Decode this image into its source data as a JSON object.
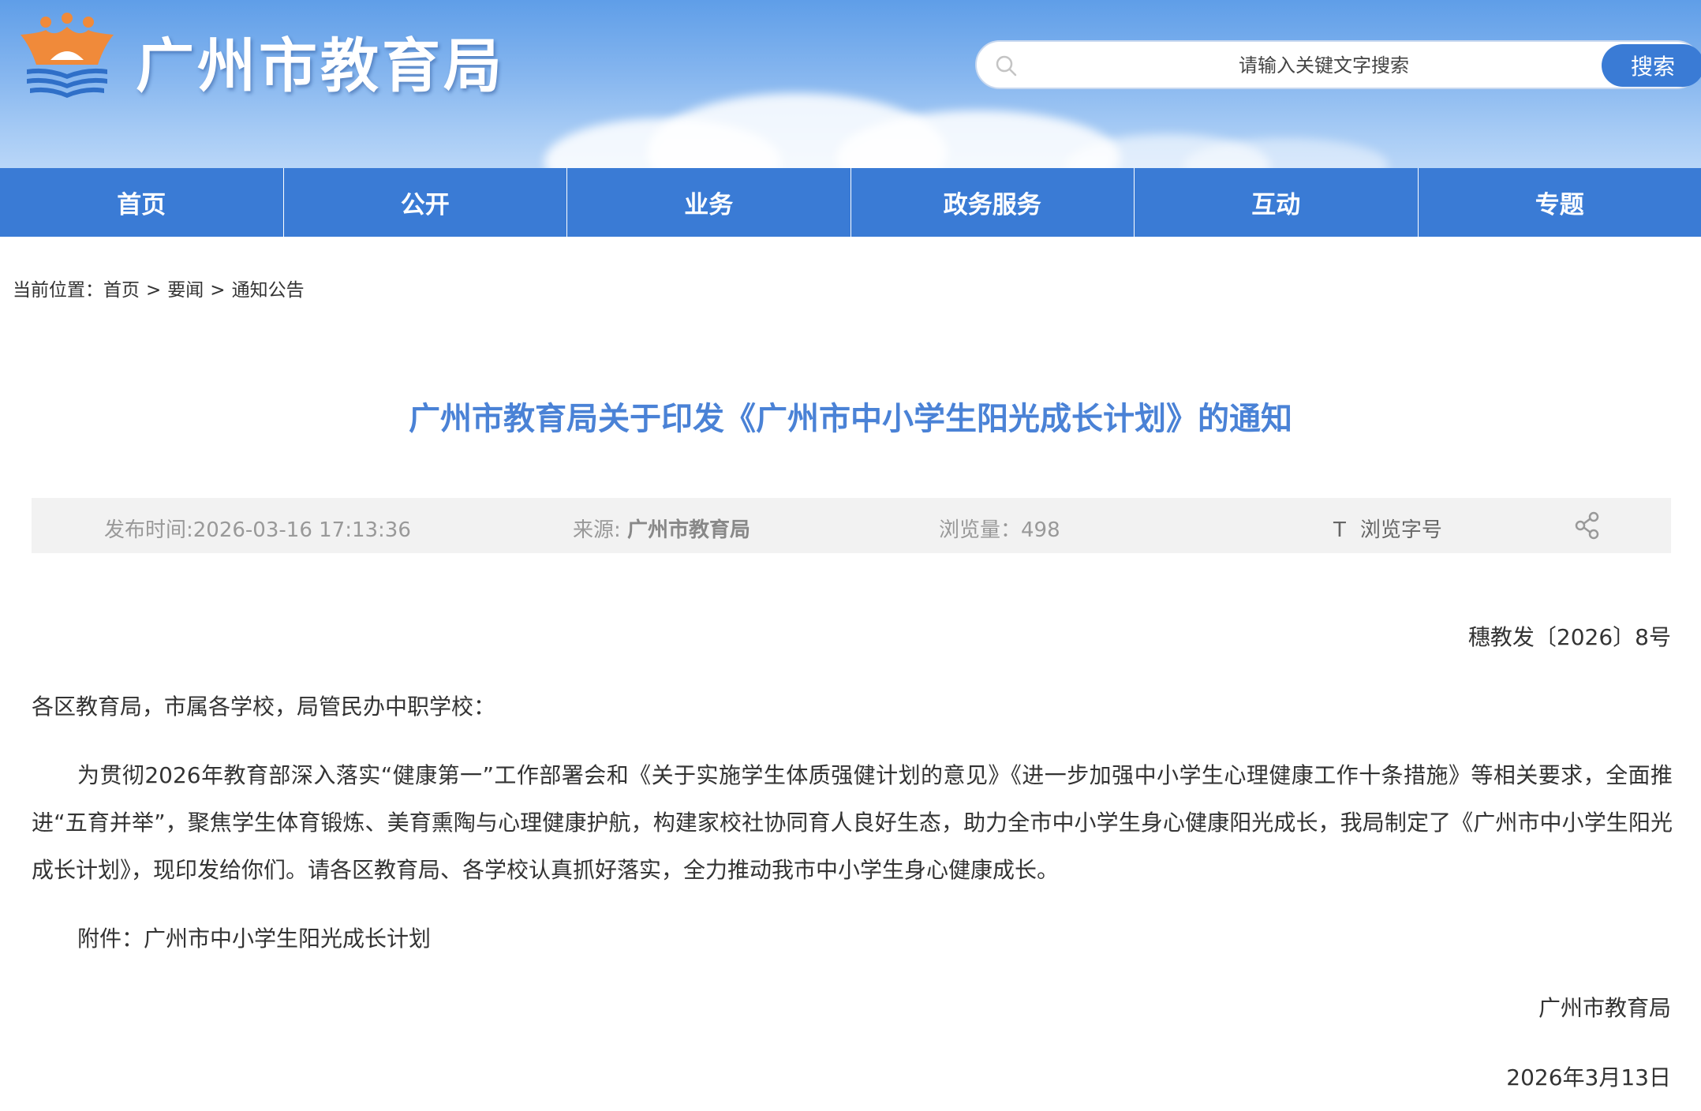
{
  "header": {
    "site_title": "广州市教育局",
    "search": {
      "placeholder": "请输入关键文字搜索",
      "button_label": "搜索"
    }
  },
  "nav": {
    "items": [
      {
        "label": "首页"
      },
      {
        "label": "公开"
      },
      {
        "label": "业务"
      },
      {
        "label": "政务服务"
      },
      {
        "label": "互动"
      },
      {
        "label": "专题"
      }
    ]
  },
  "breadcrumb": {
    "prefix": "当前位置：",
    "items": [
      "首页",
      "要闻",
      "通知公告"
    ],
    "separator": ">"
  },
  "article": {
    "title": "广州市教育局关于印发《广州市中小学生阳光成长计划》的通知",
    "meta": {
      "publish_time": "发布时间:2026-03-16 17:13:36",
      "source_label": "来源: ",
      "source_value": "广州市教育局",
      "views": "浏览量：498",
      "font_icon": "T",
      "font_label": "浏览字号"
    },
    "doc_number": "穗教发〔2026〕8号",
    "recipients": "各区教育局，市属各学校，局管民办中职学校：",
    "body": "为贯彻2026年教育部深入落实“健康第一”工作部署会和《关于实施学生体质强健计划的意见》《进一步加强中小学生心理健康工作十条措施》等相关要求，全面推进“五育并举”，聚焦学生体育锻炼、美育熏陶与心理健康护航，构建家校社协同育人良好生态，助力全市中小学生身心健康阳光成长，我局制定了《广州市中小学生阳光成长计划》，现印发给你们。请各区教育局、各学校认真抓好落实，全力推动我市中小学生身心健康成长。",
    "attachment": "附件：广州市中小学生阳光成长计划",
    "signature": "广州市教育局",
    "date": "2026年3月13日"
  },
  "colors": {
    "nav_bg": "#3a7bd5",
    "title_blue": "#4a82d6",
    "meta_bg": "#f2f2f2",
    "logo_orange": "#f08a3a",
    "logo_blue": "#2f6fc8"
  },
  "icons": {
    "logo": "education-bureau-logo",
    "search": "search-icon",
    "share": "share-icon"
  }
}
